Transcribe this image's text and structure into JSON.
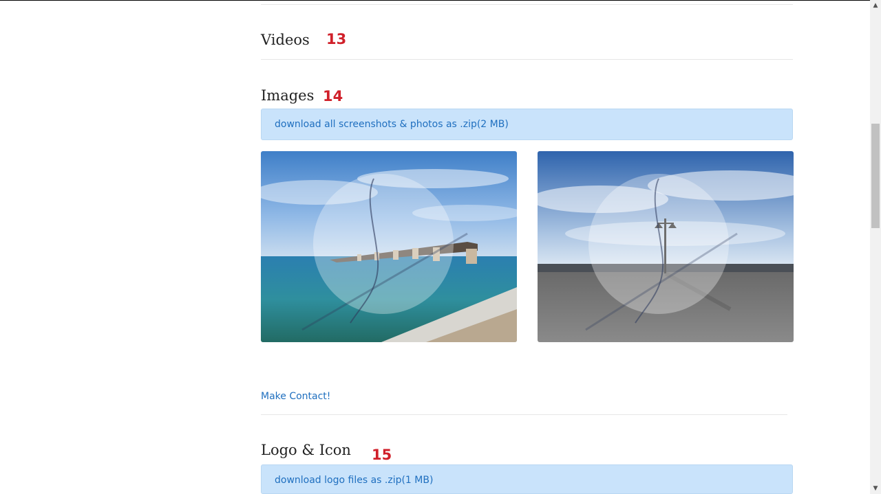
{
  "sections": {
    "videos": {
      "title": "Videos",
      "number": "13"
    },
    "images": {
      "title": "Images",
      "number": "14",
      "download_label": "download all screenshots & photos as .zip(2 MB)"
    },
    "logo": {
      "title": "Logo & Icon",
      "number": "15",
      "download_label": "download logo files as .zip(1 MB)"
    }
  },
  "contact": {
    "label": "Make Contact!"
  },
  "images": [
    {
      "name": "bridge-photo",
      "alt": "Old bridge over turquoise water"
    },
    {
      "name": "lamppost-photo",
      "alt": "Street lamp on seaside promenade"
    }
  ],
  "colors": {
    "link": "#1f6fbf",
    "highlight_box": "#c9e3fb",
    "annotation": "#d0202a"
  }
}
